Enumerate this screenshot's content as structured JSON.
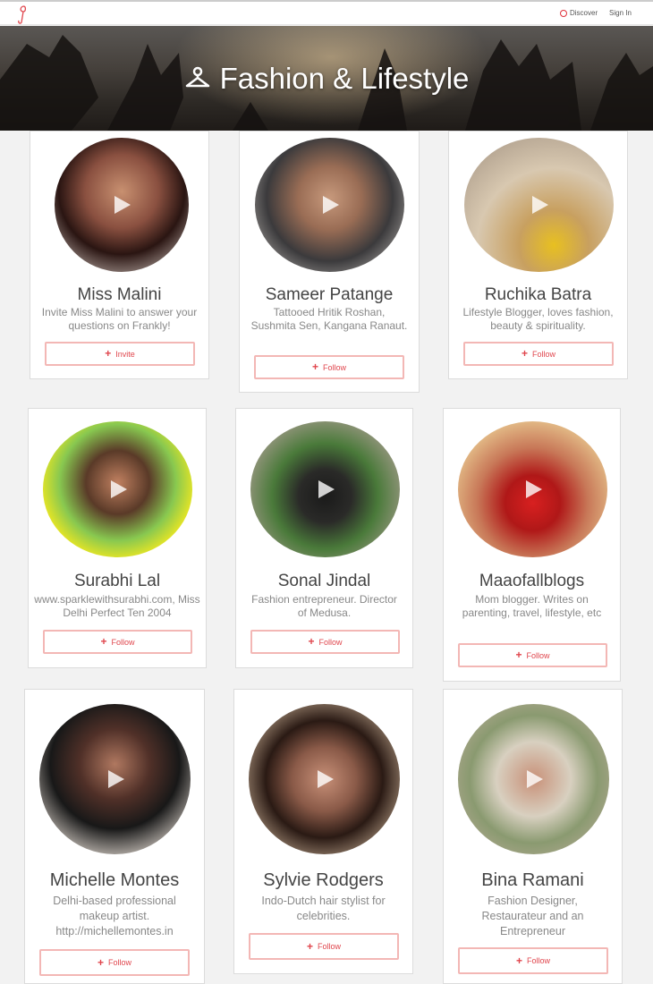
{
  "topbar": {
    "logo": "frankly-logo",
    "nav": {
      "discover": "Discover",
      "signin": "Sign In"
    }
  },
  "hero": {
    "title": "Fashion & Lifestyle",
    "icon": "hanger-icon"
  },
  "colors": {
    "accent": "#e0464d",
    "button_border": "#f3b7b5"
  },
  "cards": [
    {
      "name": "Miss Malini",
      "bio": "Invite Miss Malini to answer your questions on Frankly!",
      "action": "Invite"
    },
    {
      "name": "Sameer Patange",
      "bio": "Tattooed Hritik Roshan, Sushmita Sen, Kangana Ranaut.",
      "action": "Follow"
    },
    {
      "name": "Ruchika Batra",
      "bio": "Lifestyle Blogger, loves fashion, beauty & spirituality.",
      "action": "Follow"
    },
    {
      "name": "Surabhi Lal",
      "bio": "www.sparklewithsurabhi.com, Miss Delhi Perfect Ten 2004",
      "action": "Follow"
    },
    {
      "name": "Sonal Jindal",
      "bio": "Fashion entrepreneur. Director of Medusa.",
      "action": "Follow"
    },
    {
      "name": "Maaofallblogs",
      "bio": "Mom blogger. Writes on parenting, travel, lifestyle, etc",
      "action": "Follow"
    },
    {
      "name": "Michelle Montes",
      "bio": "Delhi-based professional makeup artist. http://michellemontes.in",
      "action": "Follow"
    },
    {
      "name": "Sylvie Rodgers",
      "bio": "Indo-Dutch hair stylist for celebrities.",
      "action": "Follow"
    },
    {
      "name": "Bina Ramani",
      "bio": "Fashion Designer, Restaurateur and an Entrepreneur",
      "action": "Follow"
    }
  ]
}
